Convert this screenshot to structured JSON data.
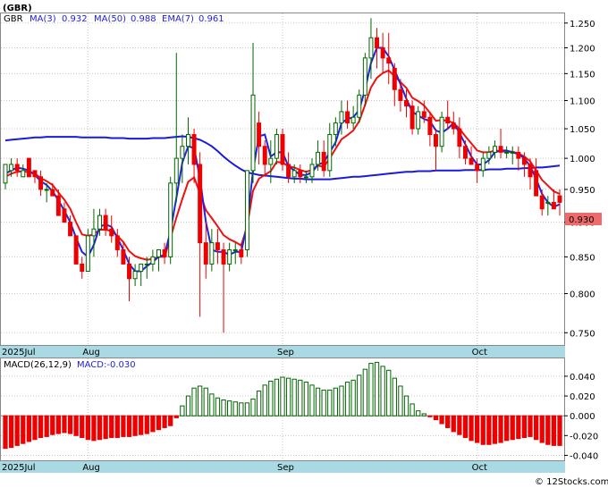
{
  "title": "(GBR)",
  "legend": {
    "ticker": "GBR",
    "ma3": "MA(3)",
    "ma3_value": "0.932",
    "ma50": "MA(50)",
    "ma50_value": "0.988",
    "ema7": "EMA(7)",
    "ema7_value": "0.961"
  },
  "last_price": "0.930",
  "macd_label": "MACD(26,12,9)",
  "macd_value": "MACD:-0.030",
  "watermark": "© 12Stocks.com",
  "colors": {
    "up": "#006600",
    "down": "#ee0000",
    "ma3": "#2222dd",
    "ma50": "#1a1add",
    "ema7": "#ee1111",
    "axisband": "#a9d9e2",
    "grid": "#c8c8c8",
    "last_price_box": "#ef6a6a"
  },
  "chart_data": [
    {
      "type": "candlestick",
      "y_ticks": [
        "1.250",
        "1.200",
        "1.150",
        "1.100",
        "1.050",
        "1.000",
        "0.950",
        "0.900",
        "0.850",
        "0.800",
        "0.750"
      ],
      "ylim": [
        0.735,
        1.27
      ],
      "x_labels": [
        "2025Jul",
        "Aug",
        "Sep",
        "Oct"
      ],
      "x_label_index": [
        0,
        14,
        47,
        80
      ],
      "grid": true,
      "log_scale": true,
      "candles": [
        [
          0.96,
          0.99,
          0.95,
          0.99
        ],
        [
          0.98,
          1.0,
          0.97,
          0.99
        ],
        [
          0.99,
          1.0,
          0.97,
          0.98
        ],
        [
          0.97,
          0.99,
          0.97,
          0.98
        ],
        [
          1.0,
          1.0,
          0.97,
          0.97
        ],
        [
          0.98,
          0.98,
          0.96,
          0.97
        ],
        [
          0.97,
          0.98,
          0.94,
          0.95
        ],
        [
          0.95,
          0.96,
          0.93,
          0.95
        ],
        [
          0.95,
          0.96,
          0.94,
          0.94
        ],
        [
          0.94,
          0.95,
          0.91,
          0.91
        ],
        [
          0.92,
          0.93,
          0.9,
          0.9
        ],
        [
          0.9,
          0.91,
          0.88,
          0.88
        ],
        [
          0.88,
          0.88,
          0.84,
          0.84
        ],
        [
          0.84,
          0.85,
          0.82,
          0.83
        ],
        [
          0.83,
          0.89,
          0.83,
          0.88
        ],
        [
          0.88,
          0.92,
          0.85,
          0.89
        ],
        [
          0.89,
          0.92,
          0.88,
          0.91
        ],
        [
          0.91,
          0.92,
          0.88,
          0.89
        ],
        [
          0.89,
          0.91,
          0.87,
          0.88
        ],
        [
          0.88,
          0.89,
          0.85,
          0.86
        ],
        [
          0.86,
          0.87,
          0.84,
          0.84
        ],
        [
          0.84,
          0.85,
          0.79,
          0.82
        ],
        [
          0.82,
          0.84,
          0.81,
          0.83
        ],
        [
          0.83,
          0.84,
          0.81,
          0.84
        ],
        [
          0.84,
          0.85,
          0.82,
          0.84
        ],
        [
          0.84,
          0.86,
          0.83,
          0.85
        ],
        [
          0.85,
          0.86,
          0.83,
          0.86
        ],
        [
          0.86,
          0.87,
          0.84,
          0.85
        ],
        [
          0.85,
          0.97,
          0.84,
          0.96
        ],
        [
          0.96,
          1.19,
          0.93,
          1.0
        ],
        [
          1.0,
          1.04,
          0.96,
          1.02
        ],
        [
          1.02,
          1.07,
          0.99,
          1.04
        ],
        [
          1.04,
          1.05,
          0.96,
          0.99
        ],
        [
          0.99,
          1.01,
          0.77,
          0.87
        ],
        [
          0.87,
          0.9,
          0.82,
          0.84
        ],
        [
          0.84,
          0.89,
          0.83,
          0.87
        ],
        [
          0.87,
          0.89,
          0.84,
          0.86
        ],
        [
          0.86,
          0.87,
          0.75,
          0.84
        ],
        [
          0.84,
          0.87,
          0.83,
          0.86
        ],
        [
          0.86,
          0.87,
          0.84,
          0.86
        ],
        [
          0.86,
          0.87,
          0.84,
          0.85
        ],
        [
          0.86,
          0.98,
          0.85,
          0.98
        ],
        [
          0.98,
          1.21,
          0.96,
          1.11
        ],
        [
          1.06,
          1.08,
          0.99,
          1.02
        ],
        [
          1.02,
          1.03,
          0.97,
          0.99
        ],
        [
          0.99,
          1.03,
          0.96,
          1.0
        ],
        [
          1.0,
          1.05,
          0.99,
          1.04
        ],
        [
          1.04,
          1.05,
          0.98,
          0.99
        ],
        [
          0.99,
          1.01,
          0.96,
          0.97
        ],
        [
          0.97,
          0.99,
          0.96,
          0.98
        ],
        [
          0.98,
          0.99,
          0.96,
          0.97
        ],
        [
          0.97,
          0.98,
          0.96,
          0.97
        ],
        [
          0.97,
          1.0,
          0.96,
          0.99
        ],
        [
          0.99,
          1.03,
          0.98,
          1.01
        ],
        [
          1.01,
          1.03,
          0.97,
          0.98
        ],
        [
          0.98,
          1.06,
          0.97,
          1.04
        ],
        [
          1.04,
          1.07,
          1.02,
          1.06
        ],
        [
          1.06,
          1.1,
          1.04,
          1.08
        ],
        [
          1.08,
          1.1,
          1.05,
          1.06
        ],
        [
          1.06,
          1.09,
          1.05,
          1.07
        ],
        [
          1.07,
          1.12,
          1.06,
          1.11
        ],
        [
          1.11,
          1.19,
          1.09,
          1.18
        ],
        [
          1.18,
          1.26,
          1.14,
          1.22
        ],
        [
          1.22,
          1.24,
          1.16,
          1.2
        ],
        [
          1.2,
          1.23,
          1.15,
          1.18
        ],
        [
          1.18,
          1.23,
          1.13,
          1.17
        ],
        [
          1.16,
          1.17,
          1.09,
          1.12
        ],
        [
          1.12,
          1.14,
          1.08,
          1.1
        ],
        [
          1.1,
          1.12,
          1.07,
          1.09
        ],
        [
          1.09,
          1.1,
          1.04,
          1.05
        ],
        [
          1.05,
          1.09,
          1.04,
          1.08
        ],
        [
          1.08,
          1.1,
          1.06,
          1.07
        ],
        [
          1.07,
          1.08,
          1.02,
          1.04
        ],
        [
          1.04,
          1.05,
          0.98,
          1.02
        ],
        [
          1.02,
          1.08,
          1.01,
          1.07
        ],
        [
          1.07,
          1.1,
          1.05,
          1.06
        ],
        [
          1.06,
          1.08,
          1.04,
          1.05
        ],
        [
          1.05,
          1.07,
          1.0,
          1.02
        ],
        [
          1.02,
          1.03,
          0.99,
          1.0
        ],
        [
          1.0,
          1.02,
          0.99,
          0.99
        ],
        [
          0.99,
          1.0,
          0.96,
          0.98
        ],
        [
          0.98,
          1.01,
          0.97,
          1.0
        ],
        [
          1.0,
          1.02,
          0.99,
          1.01
        ],
        [
          1.01,
          1.03,
          1.0,
          1.02
        ],
        [
          1.02,
          1.05,
          1.0,
          1.01
        ],
        [
          1.01,
          1.02,
          1.0,
          1.01
        ],
        [
          1.01,
          1.02,
          0.99,
          1.01
        ],
        [
          1.01,
          1.02,
          0.98,
          1.0
        ],
        [
          1.0,
          1.01,
          0.97,
          0.99
        ],
        [
          0.99,
          1.0,
          0.95,
          0.97
        ],
        [
          0.98,
          1.0,
          0.94,
          0.94
        ],
        [
          0.94,
          0.95,
          0.91,
          0.92
        ],
        [
          0.93,
          0.94,
          0.91,
          0.93
        ],
        [
          0.93,
          0.95,
          0.92,
          0.92
        ],
        [
          0.94,
          0.95,
          0.91,
          0.93
        ]
      ],
      "ma3": [
        0.975,
        0.98,
        0.985,
        0.983,
        0.98,
        0.973,
        0.963,
        0.957,
        0.947,
        0.933,
        0.917,
        0.9,
        0.877,
        0.857,
        0.85,
        0.867,
        0.893,
        0.897,
        0.893,
        0.877,
        0.86,
        0.84,
        0.83,
        0.83,
        0.837,
        0.843,
        0.85,
        0.853,
        0.887,
        0.937,
        0.993,
        1.02,
        1.017,
        0.967,
        0.9,
        0.86,
        0.857,
        0.857,
        0.853,
        0.857,
        0.857,
        0.897,
        0.98,
        1.037,
        1.04,
        1.003,
        1.01,
        1.01,
        0.987,
        0.98,
        0.973,
        0.973,
        0.977,
        0.99,
        0.993,
        1.01,
        1.027,
        1.06,
        1.067,
        1.07,
        1.083,
        1.12,
        1.17,
        1.2,
        1.2,
        1.183,
        1.157,
        1.13,
        1.103,
        1.08,
        1.073,
        1.067,
        1.063,
        1.047,
        1.043,
        1.05,
        1.06,
        1.043,
        1.023,
        1.003,
        0.99,
        0.99,
        0.997,
        1.01,
        1.013,
        1.013,
        1.01,
        1.007,
        1.0,
        0.987,
        0.967,
        0.943,
        0.93,
        0.923,
        0.927
      ],
      "ma50": [
        1.03,
        1.031,
        1.032,
        1.033,
        1.034,
        1.035,
        1.035,
        1.036,
        1.036,
        1.036,
        1.036,
        1.036,
        1.036,
        1.035,
        1.035,
        1.035,
        1.035,
        1.035,
        1.034,
        1.034,
        1.034,
        1.033,
        1.033,
        1.033,
        1.033,
        1.034,
        1.034,
        1.034,
        1.035,
        1.036,
        1.037,
        1.036,
        1.034,
        1.031,
        1.026,
        1.02,
        1.012,
        1.003,
        0.995,
        0.988,
        0.982,
        0.977,
        0.975,
        0.973,
        0.972,
        0.971,
        0.97,
        0.969,
        0.968,
        0.967,
        0.967,
        0.966,
        0.966,
        0.966,
        0.966,
        0.966,
        0.967,
        0.968,
        0.969,
        0.97,
        0.97,
        0.971,
        0.972,
        0.973,
        0.974,
        0.975,
        0.976,
        0.977,
        0.978,
        0.978,
        0.979,
        0.979,
        0.979,
        0.98,
        0.98,
        0.98,
        0.98,
        0.98,
        0.981,
        0.981,
        0.981,
        0.981,
        0.982,
        0.982,
        0.982,
        0.983,
        0.983,
        0.983,
        0.984,
        0.984,
        0.985,
        0.985,
        0.986,
        0.987,
        0.988
      ],
      "ema7": [
        0.97,
        0.975,
        0.978,
        0.979,
        0.977,
        0.975,
        0.968,
        0.963,
        0.957,
        0.945,
        0.934,
        0.92,
        0.9,
        0.882,
        0.88,
        0.882,
        0.889,
        0.889,
        0.887,
        0.88,
        0.871,
        0.858,
        0.851,
        0.848,
        0.846,
        0.847,
        0.85,
        0.85,
        0.877,
        0.907,
        0.935,
        0.962,
        0.969,
        0.944,
        0.918,
        0.906,
        0.894,
        0.881,
        0.875,
        0.871,
        0.866,
        0.894,
        0.948,
        0.967,
        0.973,
        0.979,
        0.994,
        0.993,
        0.987,
        0.985,
        0.981,
        0.978,
        0.981,
        0.988,
        0.986,
        1.0,
        1.016,
        1.032,
        1.039,
        1.047,
        1.063,
        1.092,
        1.124,
        1.142,
        1.151,
        1.156,
        1.145,
        1.134,
        1.123,
        1.105,
        1.099,
        1.091,
        1.078,
        1.064,
        1.065,
        1.064,
        1.06,
        1.05,
        1.037,
        1.025,
        1.013,
        1.01,
        1.01,
        1.013,
        1.012,
        1.011,
        1.011,
        1.008,
        1.003,
        0.995,
        0.98,
        0.965,
        0.956,
        0.947,
        0.943
      ]
    },
    {
      "type": "bar",
      "name": "MACD(26,12,9)",
      "y_ticks": [
        "0.040",
        "0.020",
        "0.000",
        "-0.020",
        "-0.040"
      ],
      "ylim": [
        -0.045,
        0.058
      ],
      "grid": true,
      "values": [
        -0.033,
        -0.032,
        -0.03,
        -0.028,
        -0.026,
        -0.024,
        -0.022,
        -0.021,
        -0.019,
        -0.018,
        -0.017,
        -0.018,
        -0.02,
        -0.022,
        -0.024,
        -0.025,
        -0.024,
        -0.023,
        -0.022,
        -0.022,
        -0.021,
        -0.021,
        -0.02,
        -0.019,
        -0.018,
        -0.016,
        -0.014,
        -0.012,
        -0.01,
        -0.002,
        0.01,
        0.02,
        0.028,
        0.03,
        0.028,
        0.022,
        0.018,
        0.016,
        0.015,
        0.014,
        0.013,
        0.013,
        0.017,
        0.025,
        0.031,
        0.035,
        0.037,
        0.039,
        0.038,
        0.037,
        0.036,
        0.034,
        0.031,
        0.028,
        0.026,
        0.026,
        0.028,
        0.03,
        0.034,
        0.036,
        0.041,
        0.047,
        0.053,
        0.054,
        0.05,
        0.046,
        0.038,
        0.03,
        0.02,
        0.012,
        0.005,
        0.002,
        -0.001,
        -0.004,
        -0.008,
        -0.012,
        -0.016,
        -0.019,
        -0.022,
        -0.025,
        -0.027,
        -0.029,
        -0.029,
        -0.028,
        -0.027,
        -0.025,
        -0.024,
        -0.023,
        -0.022,
        -0.021,
        -0.024,
        -0.027,
        -0.029,
        -0.03,
        -0.03
      ]
    }
  ]
}
